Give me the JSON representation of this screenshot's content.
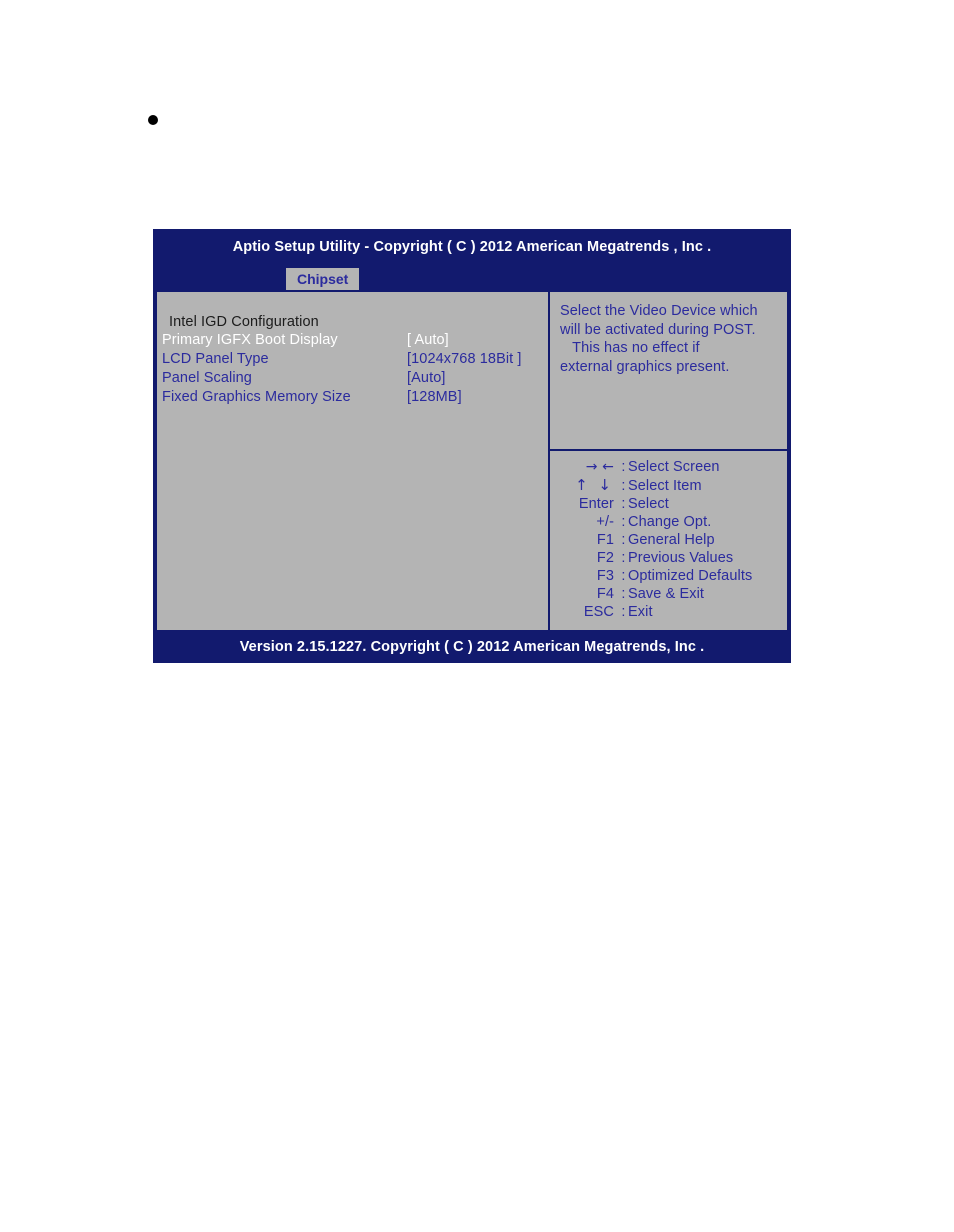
{
  "page": {
    "bullet": "•"
  },
  "bios": {
    "title": "Aptio Setup Utility - Copyright ( C ) 2012 American Megatrends , Inc .",
    "tab": "Chipset",
    "footer": "Version 2.15.1227. Copyright ( C ) 2012 American Megatrends, Inc .",
    "section_heading": "Intel IGD Configuration",
    "settings": [
      {
        "label": "Primary IGFX Boot Display",
        "value": "[ Auto]",
        "selected": true
      },
      {
        "label": "LCD Panel Type",
        "value": "[1024x768  18Bit ]",
        "selected": false
      },
      {
        "label": "Panel Scaling",
        "value": "[Auto]",
        "selected": false
      },
      {
        "label": "Fixed Graphics Memory Size",
        "value": "[128MB]",
        "selected": false
      }
    ],
    "help_lines": [
      "Select the Video Device which",
      "will be activated during POST.",
      "   This has no effect if",
      "external graphics present."
    ],
    "legend": [
      {
        "key": "→ ←",
        "sep": ":",
        "label": "Select Screen",
        "glyph": "horiz"
      },
      {
        "key": "↑ ↓",
        "sep": ":",
        "label": "Select Item",
        "glyph": "vert"
      },
      {
        "key": "Enter",
        "sep": ":",
        "label": "Select",
        "glyph": "none"
      },
      {
        "key": "+/-",
        "sep": ":",
        "label": "Change Opt.",
        "glyph": "none"
      },
      {
        "key": "F1",
        "sep": ":",
        "label": "General Help",
        "glyph": "none"
      },
      {
        "key": "F2",
        "sep": ":",
        "label": "Previous Values",
        "glyph": "none"
      },
      {
        "key": "F3",
        "sep": ":",
        "label": "Optimized Defaults",
        "glyph": "none"
      },
      {
        "key": "F4",
        "sep": ":",
        "label": "Save & Exit",
        "glyph": "none"
      },
      {
        "key": "ESC",
        "sep": ":",
        "label": "Exit",
        "glyph": "none"
      }
    ],
    "colors": {
      "window_bg": "#121a6e",
      "pane_bg": "#b4b4b4",
      "text_blue": "#2b2b9e",
      "text_white": "#ffffff",
      "heading_dark": "#1c1c1c"
    }
  }
}
